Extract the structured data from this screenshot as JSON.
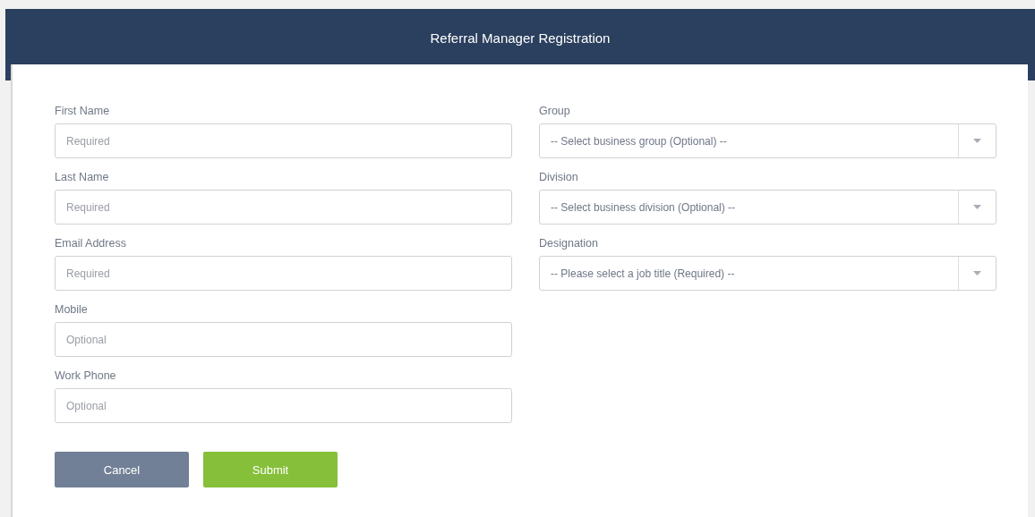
{
  "header": {
    "title": "Referral Manager Registration"
  },
  "left_fields": [
    {
      "label": "First Name",
      "placeholder": "Required"
    },
    {
      "label": "Last Name",
      "placeholder": "Required"
    },
    {
      "label": "Email Address",
      "placeholder": "Required"
    },
    {
      "label": "Mobile",
      "placeholder": "Optional"
    },
    {
      "label": "Work Phone",
      "placeholder": "Optional"
    }
  ],
  "right_fields": [
    {
      "label": "Group",
      "placeholder": "-- Select business group (Optional) --"
    },
    {
      "label": "Division",
      "placeholder": "-- Select business division (Optional) --"
    },
    {
      "label": "Designation",
      "placeholder": "-- Please select a job title  (Required) --"
    }
  ],
  "buttons": [
    {
      "label": "Cancel",
      "kind": "secondary"
    },
    {
      "label": "Submit",
      "kind": "primary"
    }
  ]
}
